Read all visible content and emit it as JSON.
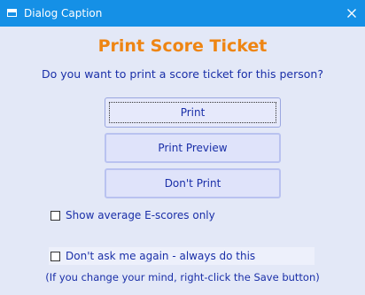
{
  "window": {
    "title": "Dialog Caption",
    "close_icon": "close-icon",
    "app_icon": "window-icon"
  },
  "dialog": {
    "heading": "Print Score Ticket",
    "question": "Do you want to print a score ticket for this person?",
    "buttons": {
      "print": "Print",
      "print_preview": "Print Preview",
      "dont_print": "Don't Print"
    },
    "options": {
      "show_average": {
        "label": "Show average E-scores only",
        "checked": false
      },
      "dont_ask": {
        "label": "Don't ask me again - always do this",
        "checked": false
      }
    },
    "footnote": "(If you change your mind, right-click the Save button)"
  },
  "colors": {
    "titlebar": "#1590e6",
    "background": "#e3e8f7",
    "heading": "#ee8513",
    "text": "#1a2fa8",
    "button_fill": "#dfe3fa",
    "button_border": "#b9c2f0"
  }
}
